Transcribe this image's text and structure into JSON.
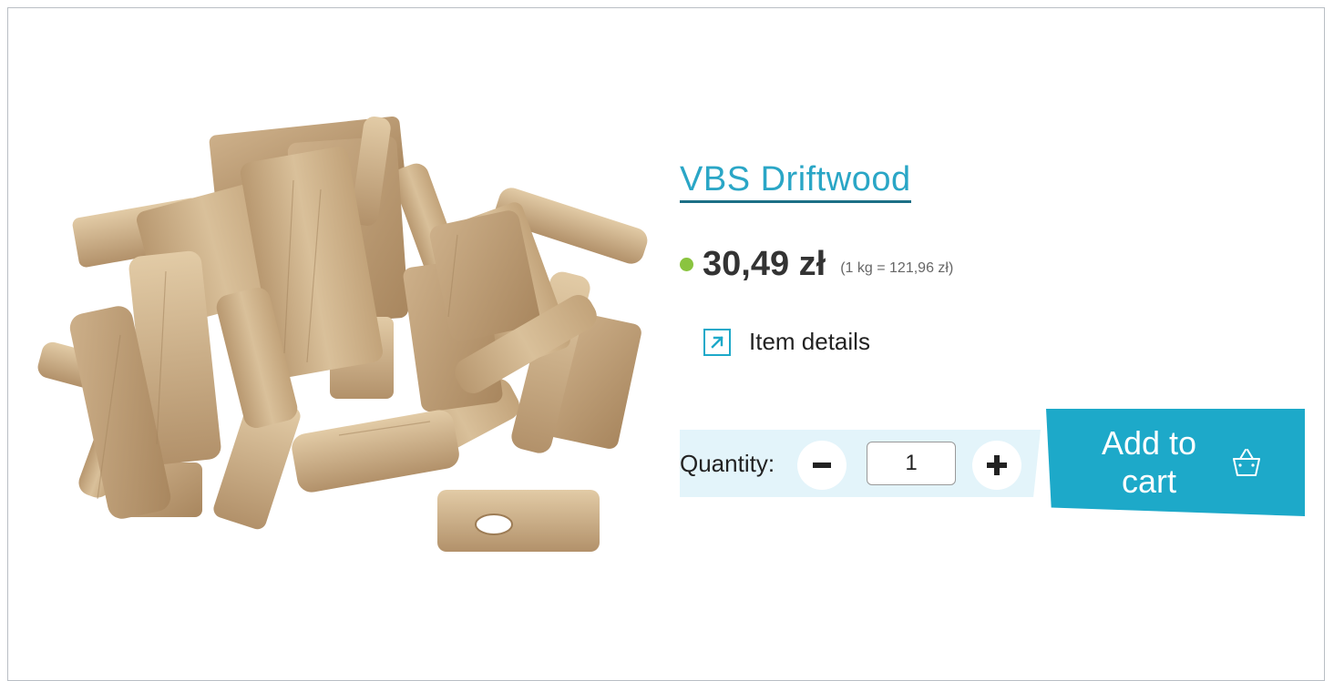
{
  "product": {
    "name": "VBS Driftwood",
    "price": "30,49 zł",
    "unit_price": "(1 kg = 121,96 zł)",
    "availability_color": "#8ac43f"
  },
  "details_link": {
    "label": "Item details",
    "icon": "external-link-arrow-icon"
  },
  "quantity": {
    "label": "Quantity:",
    "value": "1",
    "decrease_icon": "minus-icon",
    "increase_icon": "plus-icon"
  },
  "cart": {
    "label": "Add to cart",
    "icon": "basket-icon"
  },
  "colors": {
    "accent": "#1da9c9",
    "title": "#2aa6c6",
    "quantity_band": "#e3f4fa"
  }
}
